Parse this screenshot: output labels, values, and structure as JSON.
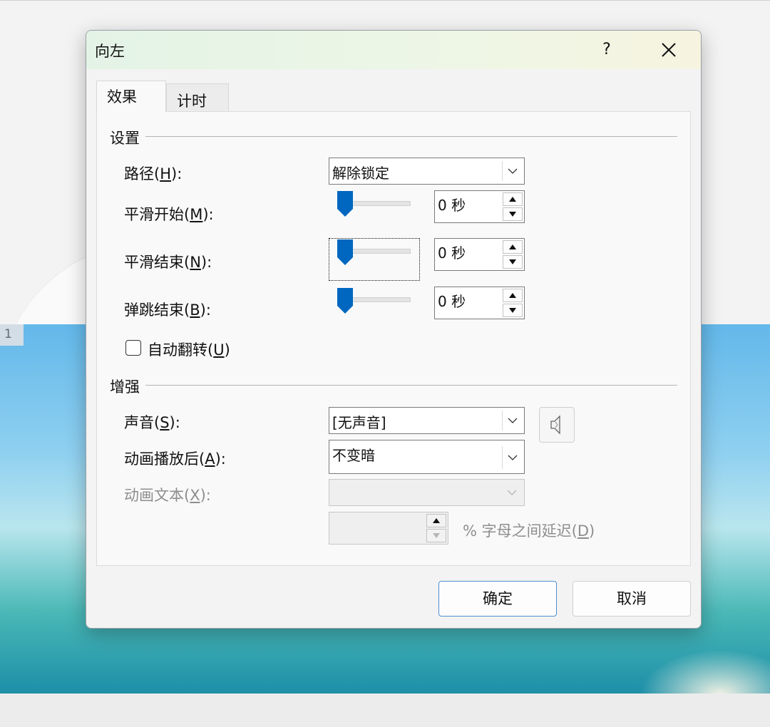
{
  "background": {
    "slide_number": "1"
  },
  "dialog": {
    "title": "向左",
    "help_label": "?",
    "tabs": [
      {
        "label": "效果"
      },
      {
        "label": "计时"
      }
    ],
    "settings": {
      "group_title": "设置",
      "path": {
        "label": "路径(",
        "hotkey": "H",
        "label_end": "):",
        "value": "解除锁定"
      },
      "smooth_start": {
        "label": "平滑开始(",
        "hotkey": "M",
        "label_end": "):",
        "value": "0 秒",
        "slider_level": 0
      },
      "smooth_end": {
        "label": "平滑结束(",
        "hotkey": "N",
        "label_end": "):",
        "value": "0 秒",
        "slider_level": 0
      },
      "bounce_end": {
        "label": "弹跳结束(",
        "hotkey": "B",
        "label_end": "):",
        "value": "0 秒",
        "slider_level": 0
      },
      "auto_reverse": {
        "label": "自动翻转(",
        "hotkey": "U",
        "label_end": ")",
        "checked": false
      }
    },
    "enhance": {
      "group_title": "增强",
      "sound": {
        "label": "声音(",
        "hotkey": "S",
        "label_end": "):",
        "value": "[无声音]"
      },
      "after_animation": {
        "label": "动画播放后(",
        "hotkey": "A",
        "label_end": "):",
        "value": "不变暗"
      },
      "animate_text": {
        "label": "动画文本(",
        "hotkey": "X",
        "label_end": "):",
        "value": ""
      },
      "letter_delay": {
        "value": "",
        "label": "% 字母之间延迟(",
        "hotkey": "D",
        "label_end": ")"
      }
    },
    "ok_label": "确定",
    "cancel_label": "取消"
  },
  "colors": {
    "accent": "#0067c0",
    "title_bar": "#e8f4e4"
  }
}
